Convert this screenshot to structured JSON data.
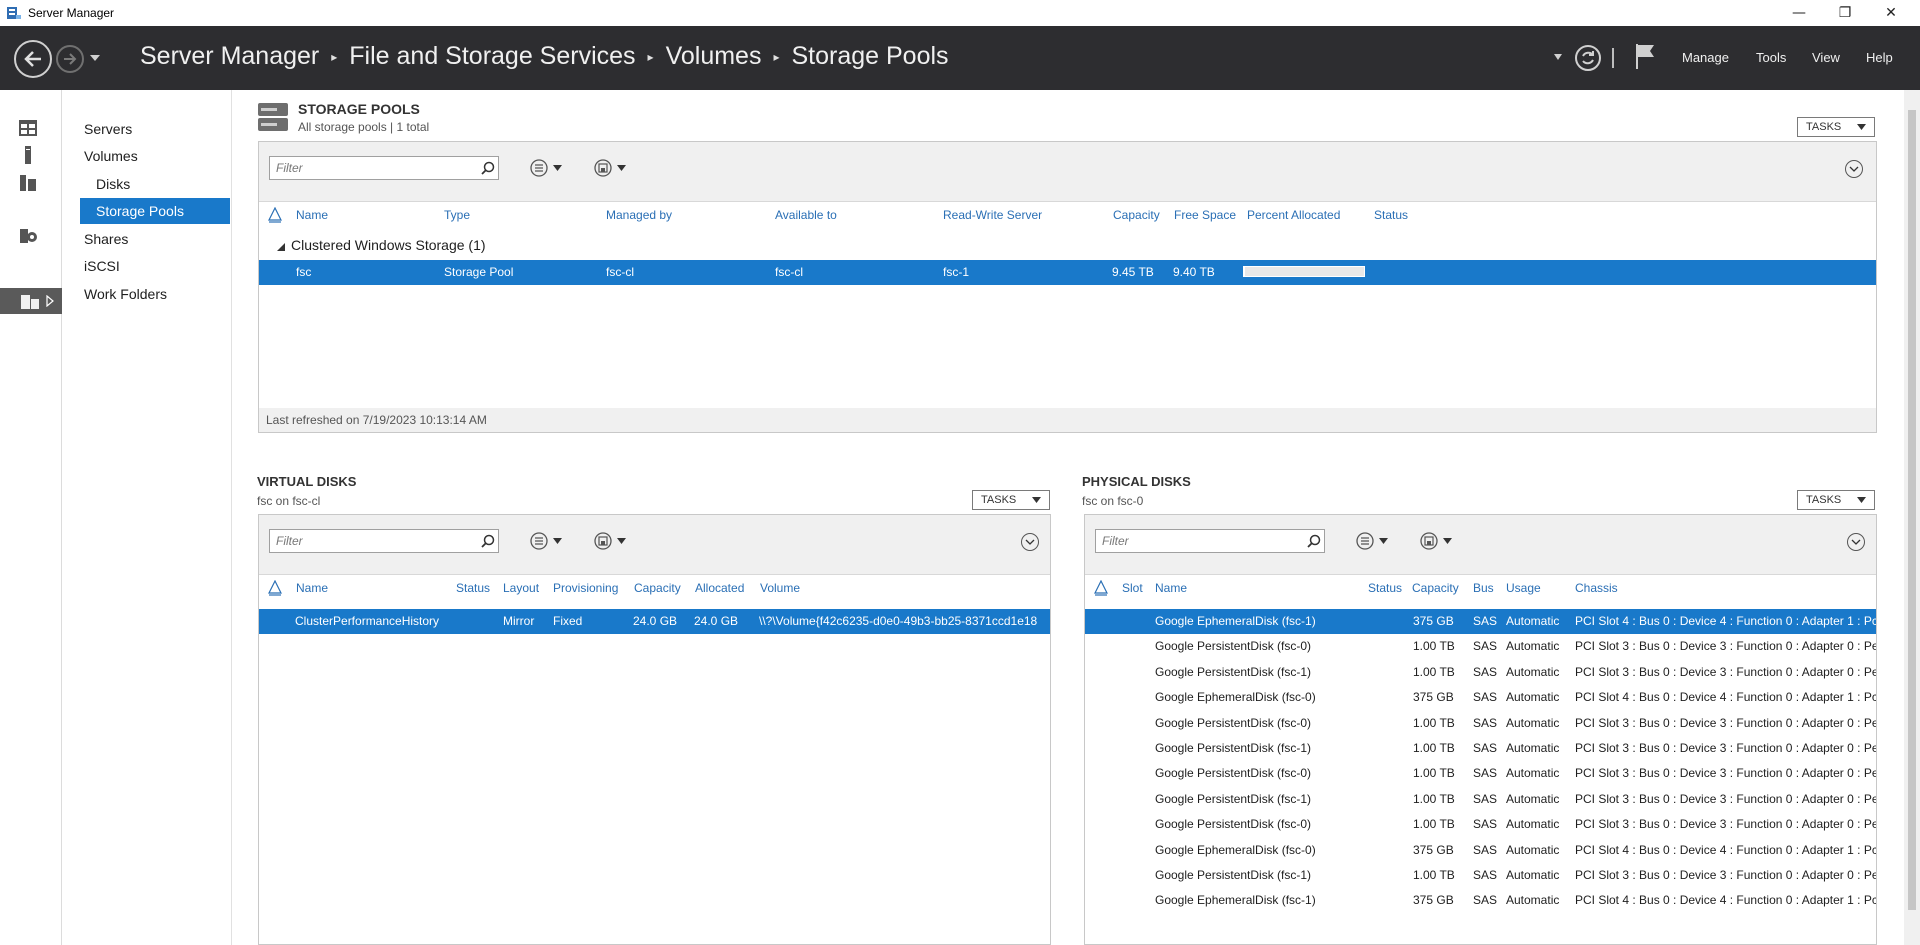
{
  "window": {
    "title": "Server Manager",
    "controls": {
      "minimize": "—",
      "restore": "❐",
      "close": "✕"
    }
  },
  "header": {
    "breadcrumb": [
      "Server Manager",
      "File and Storage Services",
      "Volumes",
      "Storage Pools"
    ],
    "menu": [
      "Manage",
      "Tools",
      "View",
      "Help"
    ]
  },
  "nav": {
    "items": [
      {
        "label": "Servers",
        "sub": false,
        "selected": false
      },
      {
        "label": "Volumes",
        "sub": false,
        "selected": false
      },
      {
        "label": "Disks",
        "sub": true,
        "selected": false
      },
      {
        "label": "Storage Pools",
        "sub": true,
        "selected": true
      },
      {
        "label": "Shares",
        "sub": false,
        "selected": false
      },
      {
        "label": "iSCSI",
        "sub": false,
        "selected": false
      },
      {
        "label": "Work Folders",
        "sub": false,
        "selected": false
      }
    ]
  },
  "storage_pools": {
    "title": "STORAGE POOLS",
    "subtitle": "All storage pools | 1 total",
    "tasks_label": "TASKS",
    "filter_placeholder": "Filter",
    "columns": [
      "Name",
      "Type",
      "Managed by",
      "Available to",
      "Read-Write Server",
      "Capacity",
      "Free Space",
      "Percent Allocated",
      "Status"
    ],
    "group_label": "Clustered Windows Storage (1)",
    "rows": [
      {
        "name": "fsc",
        "type": "Storage Pool",
        "managed_by": "fsc-cl",
        "available_to": "fsc-cl",
        "rw_server": "fsc-1",
        "capacity": "9.45 TB",
        "free_space": "9.40 TB",
        "percent_allocated": 0.5,
        "status": ""
      }
    ],
    "last_refreshed": "Last refreshed on 7/19/2023 10:13:14 AM"
  },
  "virtual_disks": {
    "title": "VIRTUAL DISKS",
    "subtitle": "fsc on fsc-cl",
    "tasks_label": "TASKS",
    "filter_placeholder": "Filter",
    "columns": [
      "Name",
      "Status",
      "Layout",
      "Provisioning",
      "Capacity",
      "Allocated",
      "Volume"
    ],
    "rows": [
      {
        "name": "ClusterPerformanceHistory",
        "status": "",
        "layout": "Mirror",
        "provisioning": "Fixed",
        "capacity": "24.0 GB",
        "allocated": "24.0 GB",
        "volume": "\\\\?\\Volume{f42c6235-d0e0-49b3-bb25-8371ccd1e18"
      }
    ]
  },
  "physical_disks": {
    "title": "PHYSICAL DISKS",
    "subtitle": "fsc on fsc-0",
    "tasks_label": "TASKS",
    "filter_placeholder": "Filter",
    "columns": [
      "Slot",
      "Name",
      "Status",
      "Capacity",
      "Bus",
      "Usage",
      "Chassis"
    ],
    "rows": [
      {
        "name": "Google EphemeralDisk (fsc-1)",
        "capacity": "375 GB",
        "bus": "SAS",
        "usage": "Automatic",
        "chassis": "PCI Slot 4 : Bus 0 : Device 4 : Function 0 : Adapter 1 : Pc"
      },
      {
        "name": "Google PersistentDisk (fsc-0)",
        "capacity": "1.00 TB",
        "bus": "SAS",
        "usage": "Automatic",
        "chassis": "PCI Slot 3 : Bus 0 : Device 3 : Function 0 : Adapter 0 : Pe"
      },
      {
        "name": "Google PersistentDisk (fsc-1)",
        "capacity": "1.00 TB",
        "bus": "SAS",
        "usage": "Automatic",
        "chassis": "PCI Slot 3 : Bus 0 : Device 3 : Function 0 : Adapter 0 : Pe"
      },
      {
        "name": "Google EphemeralDisk (fsc-0)",
        "capacity": "375 GB",
        "bus": "SAS",
        "usage": "Automatic",
        "chassis": "PCI Slot 4 : Bus 0 : Device 4 : Function 0 : Adapter 1 : Pc"
      },
      {
        "name": "Google PersistentDisk (fsc-0)",
        "capacity": "1.00 TB",
        "bus": "SAS",
        "usage": "Automatic",
        "chassis": "PCI Slot 3 : Bus 0 : Device 3 : Function 0 : Adapter 0 : Pe"
      },
      {
        "name": "Google PersistentDisk (fsc-1)",
        "capacity": "1.00 TB",
        "bus": "SAS",
        "usage": "Automatic",
        "chassis": "PCI Slot 3 : Bus 0 : Device 3 : Function 0 : Adapter 0 : Pe"
      },
      {
        "name": "Google PersistentDisk (fsc-0)",
        "capacity": "1.00 TB",
        "bus": "SAS",
        "usage": "Automatic",
        "chassis": "PCI Slot 3 : Bus 0 : Device 3 : Function 0 : Adapter 0 : Pe"
      },
      {
        "name": "Google PersistentDisk (fsc-1)",
        "capacity": "1.00 TB",
        "bus": "SAS",
        "usage": "Automatic",
        "chassis": "PCI Slot 3 : Bus 0 : Device 3 : Function 0 : Adapter 0 : Pe"
      },
      {
        "name": "Google PersistentDisk (fsc-0)",
        "capacity": "1.00 TB",
        "bus": "SAS",
        "usage": "Automatic",
        "chassis": "PCI Slot 3 : Bus 0 : Device 3 : Function 0 : Adapter 0 : Pe"
      },
      {
        "name": "Google EphemeralDisk (fsc-0)",
        "capacity": "375 GB",
        "bus": "SAS",
        "usage": "Automatic",
        "chassis": "PCI Slot 4 : Bus 0 : Device 4 : Function 0 : Adapter 1 : Pc"
      },
      {
        "name": "Google PersistentDisk (fsc-1)",
        "capacity": "1.00 TB",
        "bus": "SAS",
        "usage": "Automatic",
        "chassis": "PCI Slot 3 : Bus 0 : Device 3 : Function 0 : Adapter 0 : Pe"
      },
      {
        "name": "Google EphemeralDisk (fsc-1)",
        "capacity": "375 GB",
        "bus": "SAS",
        "usage": "Automatic",
        "chassis": "PCI Slot 4 : Bus 0 : Device 4 : Function 0 : Adapter 1 : Pc"
      }
    ]
  },
  "colors": {
    "accent": "#1979ca",
    "header_bg": "#2d2d30",
    "column_header_text": "#2a6fb5"
  },
  "icons": [
    "server-manager-icon",
    "back-arrow-icon",
    "forward-arrow-icon",
    "refresh-icon",
    "flag-icon",
    "search-icon",
    "list-view-icon",
    "save-query-icon",
    "collapse-icon",
    "sort-icon",
    "storage-pool-icon",
    "dashboard-icon",
    "local-server-icon",
    "all-servers-icon",
    "file-storage-icon",
    "rds-icon"
  ]
}
